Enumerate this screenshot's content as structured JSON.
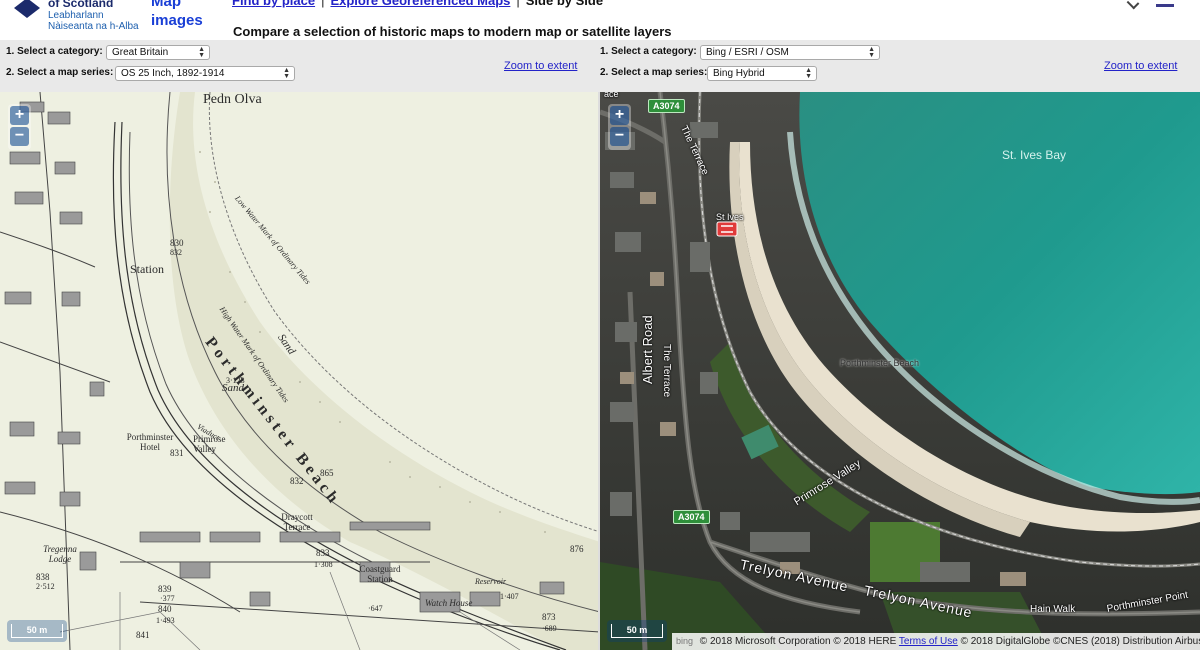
{
  "header": {
    "logo": {
      "name": "National Library of Scotland",
      "gaelic": "Leabharlann Nàiseanta na h-Alba"
    },
    "map_images_link": "Map images",
    "nav": {
      "find_by_place": "Find by place",
      "explore_georeferenced": "Explore Georeferenced Maps",
      "side_by_side": "Side by Side",
      "separator": "|"
    },
    "subtitle": "Compare a selection of historic maps to modern map or satellite layers"
  },
  "left_controls": {
    "category_label": "1. Select a category:",
    "category_value": "Great Britain",
    "series_label": "2. Select a map series:",
    "series_value": "OS 25 Inch, 1892-1914",
    "zoom_to_extent": "Zoom to extent"
  },
  "right_controls": {
    "category_label": "1. Select a category:",
    "category_value": "Bing / ESRI / OSM",
    "series_label": "2. Select a map series:",
    "series_value": "Bing Hybrid",
    "zoom_to_extent": "Zoom to extent"
  },
  "left_map": {
    "zoom_in": "+",
    "zoom_out": "−",
    "scale": "50 m",
    "labels": {
      "pedn_olva": "Pedn Olva",
      "station": "Station",
      "porthminster_beach": "Porthminster Beach",
      "low_water": "Low Water Mark of Ordinary Tides",
      "high_water": "High Water Mark of Ordinary Tides",
      "sand1": "Sand",
      "sand2": "Sand",
      "hotel": "Porthminster Hotel",
      "viaduct": "Viaduct",
      "primrose_valley": "Primrose Valley",
      "draycott": "Draycott Terrace",
      "coastguard": "Coastguard Station",
      "watch_house": "Watch House",
      "tregenna_lodge": "Tregenna Lodge",
      "reservoir": "Reservoir",
      "p830": "830",
      "p831": "831",
      "p832": "832",
      "p833": "833",
      "p838": "838",
      "p839": "839",
      "p840": "840",
      "p841": "841",
      "p865": "865",
      "p873": "873",
      "p876": "876",
      "a832": "832",
      "a2512": "2·512",
      "a123": "3·123",
      "a1308": "1·308",
      "a377": "·377",
      "a1493": "1·493",
      "a647": "·647",
      "a1407": "1·407",
      "a689": "·689"
    }
  },
  "right_map": {
    "zoom_in": "+",
    "zoom_out": "−",
    "scale": "50 m",
    "labels": {
      "st_ives_bay": "St. Ives Bay",
      "st_ives": "St Ives",
      "porthminster_beach": "Porthminster Beach",
      "the_terrace_top": "The Terrace",
      "the_terrace": "The Terrace",
      "albert_road": "Albert Road",
      "primrose_valley": "Primrose Valley",
      "trelyon_avenue_1": "Trelyon Avenue",
      "trelyon_avenue_2": "Trelyon Avenue",
      "hain_walk": "Hain Walk",
      "porthminster_point": "Porthminster Point",
      "a3074_top": "A3074",
      "a3074_bottom": "A3074",
      "ace": "ace"
    },
    "attribution": {
      "bing": "bing",
      "text1": "© 2018 Microsoft Corporation © 2018 HERE",
      "terms": "Terms of Use",
      "text2": "© 2018 DigitalGlobe ©CNES (2018) Distribution Airbus DS"
    }
  },
  "colors": {
    "link_blue": "#2323c8",
    "sea": "#1f9a8e",
    "sand": "#e8e0cf",
    "historic_paper": "#eef0e1",
    "road_green": "#2e8f3a"
  }
}
